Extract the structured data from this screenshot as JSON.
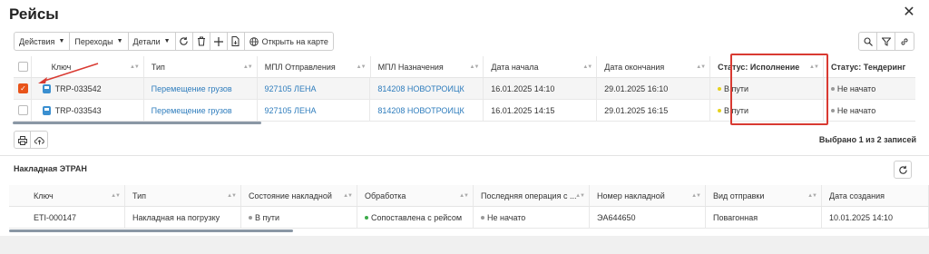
{
  "window": {
    "title": "Рейсы",
    "close_icon": "close-icon"
  },
  "toolbar": {
    "actions_label": "Действия",
    "transitions_label": "Переходы",
    "details_label": "Детали",
    "refresh_icon": "refresh-icon",
    "delete_icon": "trash-icon",
    "add_icon": "plus-icon",
    "export_icon": "document-icon",
    "open_map_label": "Открыть на карте",
    "right_icons": [
      "search-icon",
      "filter-icon",
      "link-icon"
    ]
  },
  "trips_table": {
    "columns": [
      "Ключ",
      "Тип",
      "МПЛ Отправления",
      "МПЛ Назначения",
      "Дата начала",
      "Дата окончания",
      "Статус: Исполнение",
      "Статус: Тендеринг"
    ],
    "rows": [
      {
        "checked": true,
        "key": "TRP-033542",
        "type": "Перемещение грузов",
        "from": "927105 ЛЕНА",
        "to": "814208 НОВОТРОИЦК",
        "start": "16.01.2025 14:10",
        "end": "29.01.2025 16:10",
        "exec_status": "В пути",
        "tender_status": "Не начато"
      },
      {
        "checked": false,
        "key": "TRP-033543",
        "type": "Перемещение грузов",
        "from": "927105 ЛЕНА",
        "to": "814208 НОВОТРОИЦК",
        "start": "16.01.2025 14:15",
        "end": "29.01.2025 16:15",
        "exec_status": "В пути",
        "tender_status": "Не начато"
      }
    ],
    "selection_text": "Выбрано 1 из 2 записей"
  },
  "invoices": {
    "title": "Накладная ЭТРАН",
    "columns": [
      "Ключ",
      "Тип",
      "Состояние накладной",
      "Обработка",
      "Последняя операция с ...",
      "Номер накладной",
      "Вид отправки",
      "Дата создания"
    ],
    "rows": [
      {
        "key": "ETI-000147",
        "type": "Накладная на погрузку",
        "state": "В пути",
        "processing": "Сопоставлена с рейсом",
        "last_op": "Не начато",
        "number": "ЭА644650",
        "shipment": "Повагонная",
        "created": "10.01.2025 14:10"
      }
    ]
  },
  "colors": {
    "accent": "#e8541a",
    "link": "#2f7dbd",
    "highlight": "#d93a32",
    "status_yellow": "#e6d21c",
    "status_green": "#3cab4a",
    "status_gray": "#999999"
  }
}
